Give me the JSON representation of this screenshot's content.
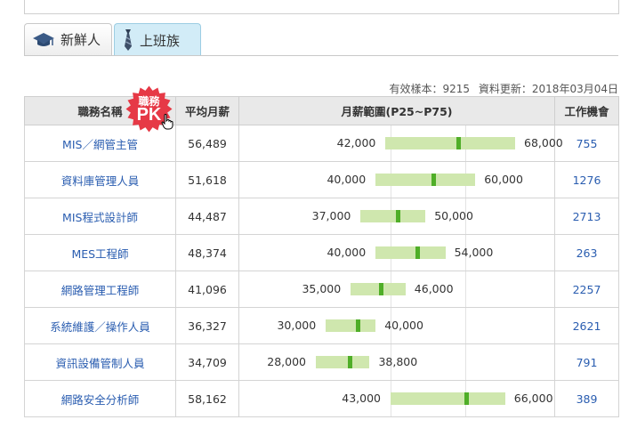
{
  "tabs": [
    {
      "label": "新鮮人",
      "icon": "graduation-cap-icon",
      "active": false
    },
    {
      "label": "上班族",
      "icon": "necktie-icon",
      "active": true
    }
  ],
  "meta": {
    "sample": "有效樣本：9215",
    "updated": "資料更新：2018年03月04日"
  },
  "table": {
    "headers": {
      "name": "職務名稱",
      "avg": "平均月薪",
      "range": "月薪範圍(P25~P75)",
      "opp": "工作機會"
    },
    "pk_badge": {
      "line1": "職務",
      "line2": "PK"
    },
    "rows": [
      {
        "name": "MIS／網管主管",
        "avg": "56,489",
        "low": "42,000",
        "high": "68,000",
        "opp": "755"
      },
      {
        "name": "資料庫管理人員",
        "avg": "51,618",
        "low": "40,000",
        "high": "60,000",
        "opp": "1276"
      },
      {
        "name": "MIS程式設計師",
        "avg": "44,487",
        "low": "37,000",
        "high": "50,000",
        "opp": "2713"
      },
      {
        "name": "MES工程師",
        "avg": "48,374",
        "low": "40,000",
        "high": "54,000",
        "opp": "263"
      },
      {
        "name": "網路管理工程師",
        "avg": "41,096",
        "low": "35,000",
        "high": "46,000",
        "opp": "2257"
      },
      {
        "name": "系統維護／操作人員",
        "avg": "36,327",
        "low": "30,000",
        "high": "40,000",
        "opp": "2621"
      },
      {
        "name": "資訊設備管制人員",
        "avg": "34,709",
        "low": "28,000",
        "high": "38,800",
        "opp": "791"
      },
      {
        "name": "網路安全分析師",
        "avg": "58,162",
        "low": "43,000",
        "high": "66,000",
        "opp": "389"
      }
    ]
  },
  "colors": {
    "bar": "#cfe7ae",
    "marker": "#4fae28",
    "link": "#2a5db0",
    "header_bg": "#e9e9e9"
  }
}
